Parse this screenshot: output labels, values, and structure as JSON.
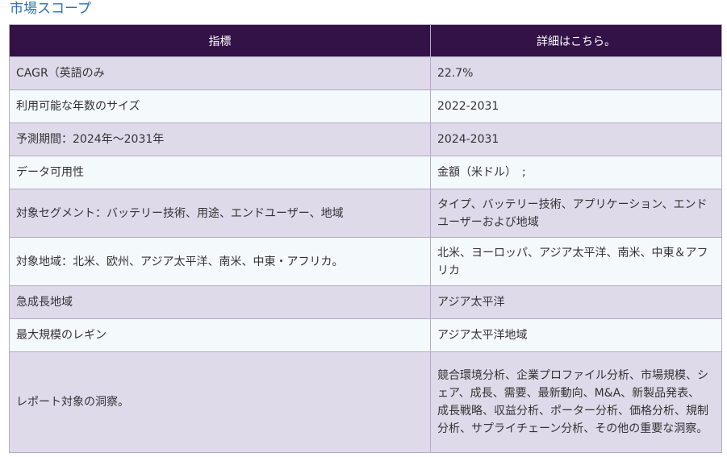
{
  "section_title": "市場スコープ",
  "table": {
    "headers": [
      "指標",
      "詳細はこちら。"
    ],
    "rows": [
      {
        "metric": "CAGR（英語のみ",
        "detail": "22.7%"
      },
      {
        "metric": "利用可能な年数のサイズ",
        "detail": "2022-2031"
      },
      {
        "metric": "予測期間：2024年～2031年",
        "detail": "2024-2031"
      },
      {
        "metric": "データ可用性",
        "detail": "金額（米ドル）　;"
      },
      {
        "metric": "対象セグメント：バッテリー技術、用途、エンドユーザー、地域",
        "detail": "タイプ、バッテリー技術、アプリケーション、エンドユーザーおよび地域"
      },
      {
        "metric": "対象地域：北米、欧州、アジア太平洋、南米、中東・アフリカ。",
        "detail": "北米、ヨーロッパ、アジア太平洋、南米、中東＆アフリカ"
      },
      {
        "metric": "急成長地域",
        "detail": "アジア太平洋"
      },
      {
        "metric": "最大規模のレギン",
        "detail": "アジア太平洋地域"
      },
      {
        "metric": "レポート対象の洞察。",
        "detail": "競合環境分析、企業プロファイル分析、市場規模、シェア、成長、需要、最新動向、M&A、新製品発表、成長戦略、収益分析、ポーター分析、価格分析、規制分析、サプライチェーン分析、その他の重要な洞察。"
      }
    ]
  },
  "colors": {
    "header_bg": "#331248",
    "row_odd_bg": "#dedaea",
    "row_even_bg": "#f4f9fc",
    "title_color": "#2f6fb5"
  }
}
